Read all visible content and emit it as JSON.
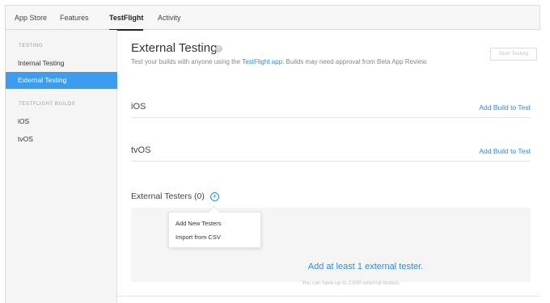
{
  "tabs": {
    "app_store": "App Store",
    "features": "Features",
    "testflight": "TestFlight",
    "activity": "Activity"
  },
  "sidebar": {
    "testing_heading": "TESTING",
    "internal_testing": "Internal Testing",
    "external_testing": "External Testing",
    "builds_heading": "TESTFLIGHT BUILDS",
    "ios": "iOS",
    "tvos": "tvOS"
  },
  "main": {
    "title": "External Testing",
    "help_glyph": "?",
    "subtitle_pre": "Test your builds with anyone using the ",
    "subtitle_link": "TestFlight app",
    "subtitle_post": ". Builds may need approval from Beta App Review.",
    "start_testing": "Start Testing",
    "ios_label": "iOS",
    "tvos_label": "tvOS",
    "add_build": "Add Build to Test",
    "testers_heading": "External Testers (0)",
    "add_glyph": "+",
    "empty_main": "Add at least 1 external tester.",
    "empty_sub": "You can have up to 2,000 external testers."
  },
  "popup": {
    "add_new": "Add New Testers",
    "import_csv": "Import from CSV"
  },
  "colors": {
    "accent": "#2a8be8",
    "sidebar_active": "#3b9cf0"
  }
}
